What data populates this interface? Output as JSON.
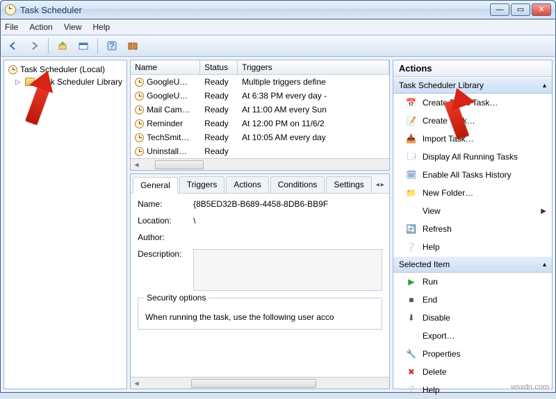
{
  "window": {
    "title": "Task Scheduler"
  },
  "menu": [
    "File",
    "Action",
    "View",
    "Help"
  ],
  "tree": {
    "root": "Task Scheduler (Local)",
    "child": "Task Scheduler Library"
  },
  "columns": [
    "Name",
    "Status",
    "Triggers"
  ],
  "tasks": [
    {
      "name": "GoogleU…",
      "status": "Ready",
      "trigger": "Multiple triggers define"
    },
    {
      "name": "GoogleU…",
      "status": "Ready",
      "trigger": "At 6:38 PM every day - "
    },
    {
      "name": "Mail Cam…",
      "status": "Ready",
      "trigger": "At 11:00 AM every Sun"
    },
    {
      "name": "Reminder",
      "status": "Ready",
      "trigger": "At 12:00 PM on 11/6/2"
    },
    {
      "name": "TechSmit…",
      "status": "Ready",
      "trigger": "At 10:05 AM every day"
    },
    {
      "name": "Uninstall…",
      "status": "Ready",
      "trigger": ""
    }
  ],
  "tabs": [
    "General",
    "Triggers",
    "Actions",
    "Conditions",
    "Settings"
  ],
  "general": {
    "name_label": "Name:",
    "name_value": "{8B5ED32B-B689-4458-8DB6-BB9F",
    "location_label": "Location:",
    "location_value": "\\",
    "author_label": "Author:",
    "description_label": "Description:",
    "security_group": "Security options",
    "security_text": "When running the task, use the following user acco"
  },
  "actions": {
    "header": "Actions",
    "section1": "Task Scheduler Library",
    "items1": [
      "Create Basic Task…",
      "Create Task…",
      "Import Task…",
      "Display All Running Tasks",
      "Enable All Tasks History",
      "New Folder…",
      "View",
      "Refresh",
      "Help"
    ],
    "section2": "Selected Item",
    "items2": [
      "Run",
      "End",
      "Disable",
      "Export…",
      "Properties",
      "Delete",
      "Help"
    ]
  },
  "watermark": "wsxdn.com"
}
